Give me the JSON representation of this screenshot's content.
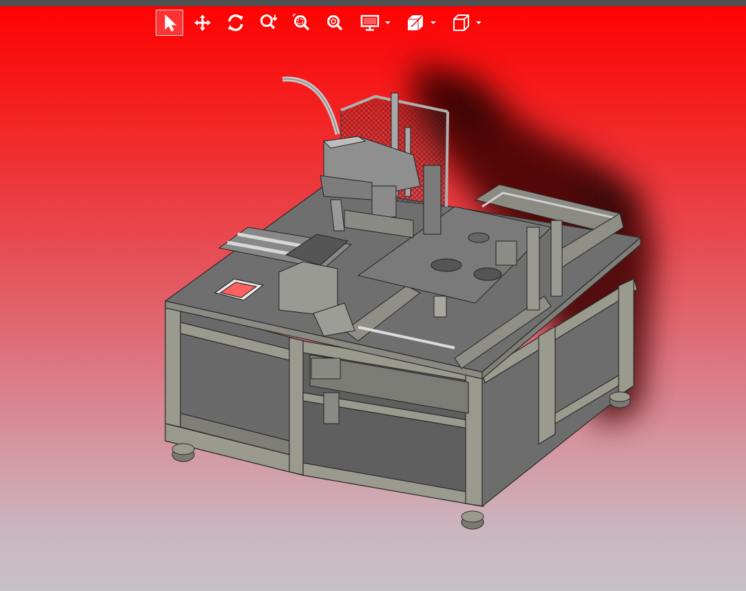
{
  "viewer": {
    "toolbar": {
      "tools": [
        {
          "id": "select",
          "icon": "cursor-arrow-icon",
          "active": true
        },
        {
          "id": "pan",
          "icon": "move-arrows-icon"
        },
        {
          "id": "rotate",
          "icon": "rotate-icon"
        },
        {
          "id": "zoom",
          "icon": "zoom-scroll-icon"
        },
        {
          "id": "zoom-window",
          "icon": "zoom-window-icon"
        },
        {
          "id": "zoom-fit",
          "icon": "zoom-fit-icon"
        },
        {
          "id": "display-mode",
          "icon": "monitor-icon",
          "has_dropdown": true
        },
        {
          "id": "section",
          "icon": "section-view-icon",
          "has_dropdown": true
        },
        {
          "id": "view-cube",
          "icon": "view-cube-icon",
          "has_dropdown": true
        }
      ]
    },
    "colors": {
      "background_top": "#ff0000",
      "background_bottom": "#c6c0c8",
      "topbar": "#505050",
      "icon": "#ffffff",
      "model_gray": "#777777",
      "model_edge": "#2a2a2a",
      "frame_light": "#9a9a8e"
    }
  }
}
